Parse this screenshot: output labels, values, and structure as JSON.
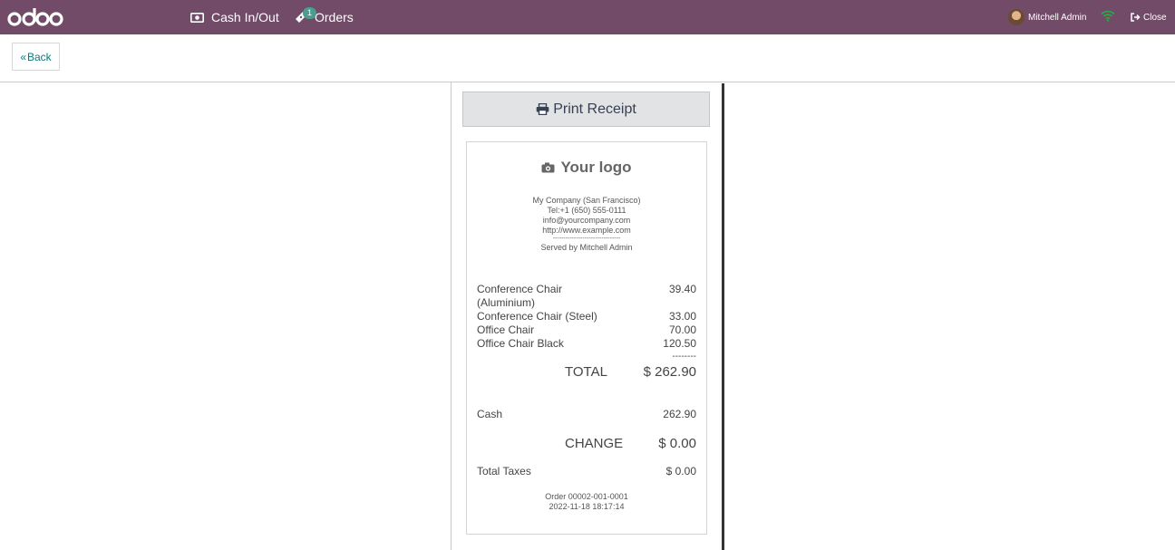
{
  "topbar": {
    "brand": "odoo",
    "cash_label": "Cash In/Out",
    "orders_label": "Orders",
    "orders_badge": "1",
    "user_name": "Mitchell Admin",
    "close_label": "Close",
    "bg_color": "#714b67",
    "wifi_color": "#28a745"
  },
  "controlbar": {
    "back_label": "Back"
  },
  "print_button": {
    "label": "Print Receipt"
  },
  "receipt": {
    "logo_text": "Your logo",
    "company_name": "My Company (San Francisco)",
    "phone": "Tel:+1 (650) 555-0111",
    "email": "info@yourcompany.com",
    "website": "http://www.example.com",
    "separator": "--------------------------------",
    "served_by": "Served by Mitchell Admin",
    "lines": [
      {
        "name": "Conference Chair (Aluminium)",
        "amount": "39.40"
      },
      {
        "name": "Conference Chair (Steel)",
        "amount": "33.00"
      },
      {
        "name": "Office Chair",
        "amount": "70.00"
      },
      {
        "name": "Office Chair Black",
        "amount": "120.50"
      }
    ],
    "subtotal_dash": "--------",
    "total_label": "TOTAL",
    "total_value": "$ 262.90",
    "payment_method": "Cash",
    "payment_amount": "262.90",
    "change_label": "CHANGE",
    "change_value": "$ 0.00",
    "taxes_label": "Total Taxes",
    "taxes_value": "$ 0.00",
    "order_ref": "Order 00002-001-0001",
    "order_date": "2022-11-18 18:17:14"
  }
}
